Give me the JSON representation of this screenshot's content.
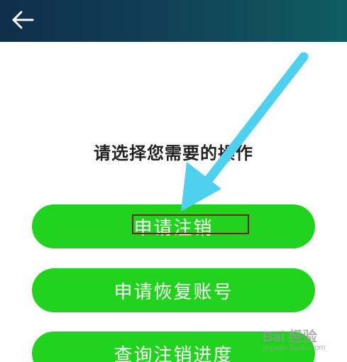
{
  "header": {
    "back_icon": "arrow-left-icon"
  },
  "main": {
    "prompt": "请选择您需要的操作",
    "buttons": [
      {
        "label": "申请注销"
      },
      {
        "label": "申请恢复账号"
      },
      {
        "label": "查询注销进度"
      }
    ]
  },
  "colors": {
    "header_start": "#0f2f4a",
    "header_end": "#0f5d63",
    "button_green": "#21d31f",
    "annotation_arrow": "#4fd0ef",
    "highlight_border": "#7a1f1f"
  },
  "watermark": {
    "brand": "Bai 经验",
    "url": "jingyan.baidu.com"
  }
}
